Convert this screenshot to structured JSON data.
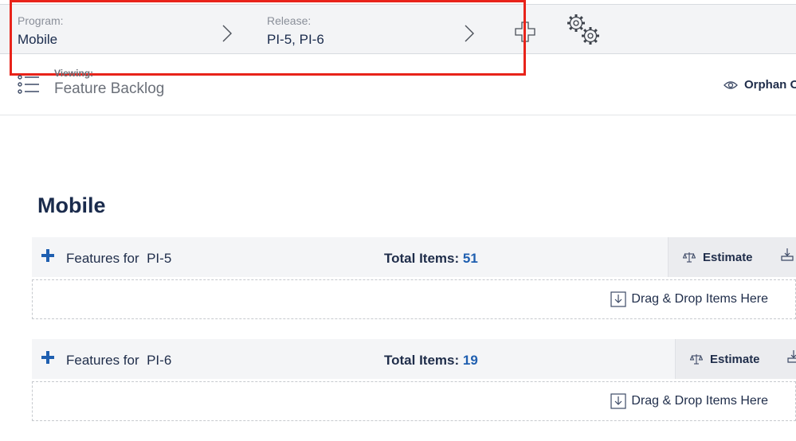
{
  "context_bar": {
    "program": {
      "label": "Program:",
      "value": "Mobile"
    },
    "release": {
      "label": "Release:",
      "value": "PI-5, PI-6"
    }
  },
  "view": {
    "label": "Viewing:",
    "value": "Feature Backlog",
    "orphan_label": "Orphan O"
  },
  "program_title": "Mobile",
  "sections": [
    {
      "title": "Features for  PI-5",
      "total_label": "Total Items:",
      "total_count": "51",
      "estimate_label": "Estimate",
      "drop_label": "Drag & Drop Items Here"
    },
    {
      "title": "Features for  PI-6",
      "total_label": "Total Items:",
      "total_count": "19",
      "estimate_label": "Estimate",
      "drop_label": "Drag & Drop Items Here"
    }
  ],
  "colors": {
    "accent": "#1f5fb0",
    "highlight": "#e8231a",
    "text": "#1f2d4a"
  }
}
